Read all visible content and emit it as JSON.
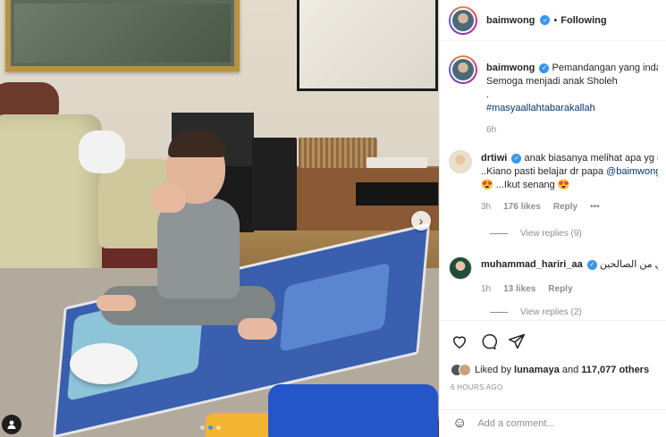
{
  "post": {
    "author": "baimwong",
    "follow_status": "Following",
    "dot": "•"
  },
  "caption": {
    "username": "baimwong",
    "line1": "Pemandangan yang indah",
    "line2": "Semoga menjadi anak Sholeh",
    "line3": ".",
    "hashtag": "#masyaallahtabarakallah",
    "time": "6h"
  },
  "comments": [
    {
      "username": "drtiwi",
      "line1": "anak biasanya melihat apa yg d",
      "line2_prefix": "..Kiano pasti belajar dr papa ",
      "mention": "@baimwong",
      "line3": "😍 ...Ikut senang 😍",
      "time": "3h",
      "likes": "176 likes",
      "reply": "Reply",
      "more": "•••",
      "view_replies": "View replies (9)"
    },
    {
      "username": "muhammad_hariri_aa",
      "line1": "ي من الصالحين",
      "time": "1h",
      "likes": "13 likes",
      "reply": "Reply",
      "view_replies": "View replies (2)"
    }
  ],
  "likes": {
    "prefix": "Liked by ",
    "user": "lunamaya",
    "middle": " and ",
    "count": "117,077 others"
  },
  "timestamp": "6 HOURS AGO",
  "add_comment": {
    "placeholder": "Add a comment...",
    "emoji": "☺"
  },
  "carousel": {
    "next_glyph": "›",
    "dots": 3,
    "active_dot": 1
  },
  "colors": {
    "verified": "#3897f0",
    "link": "#00376b",
    "muted": "#8e8e8e"
  }
}
